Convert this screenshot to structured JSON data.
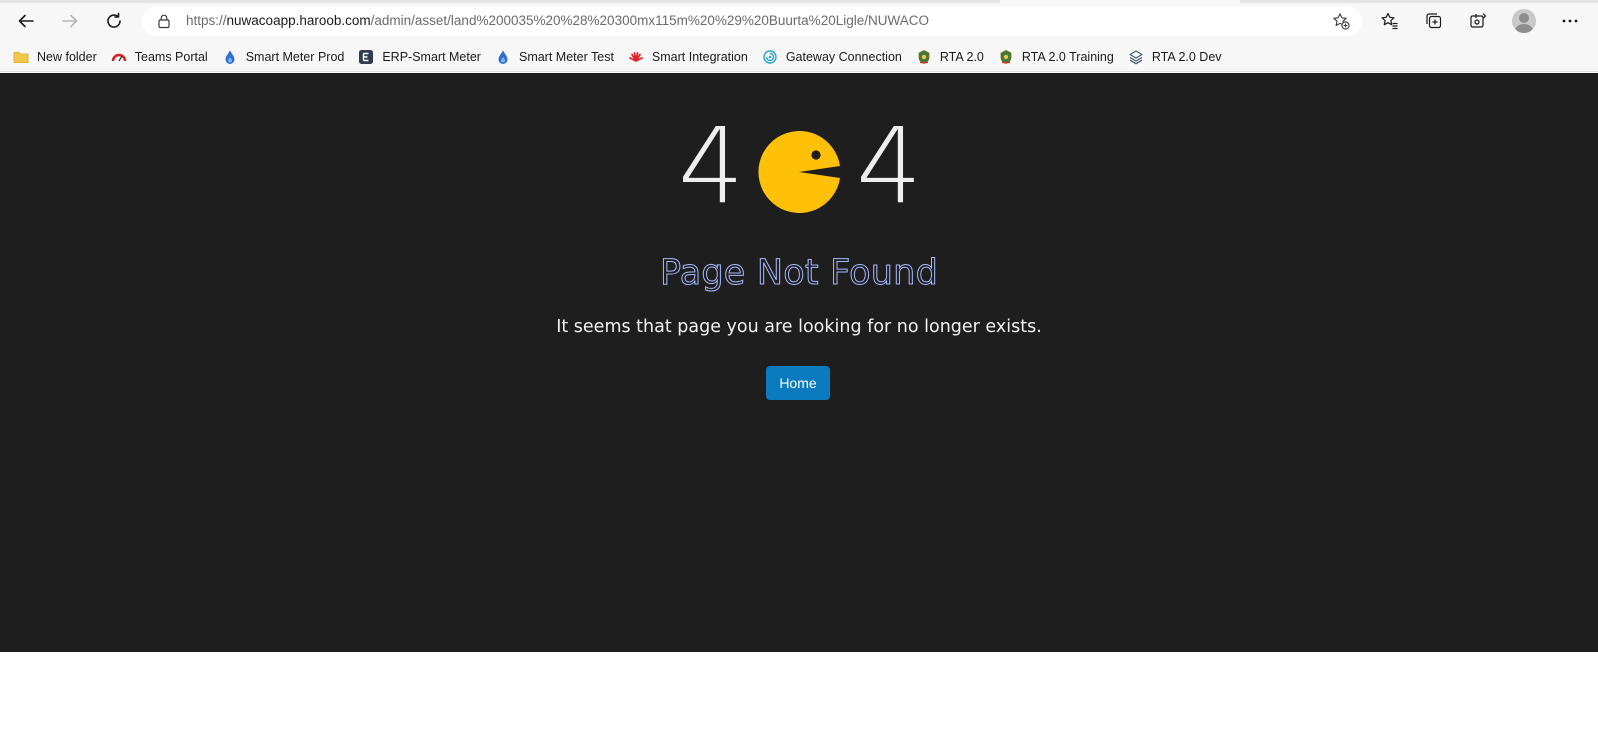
{
  "browser": {
    "url_prefix": "https://",
    "url_host": "nuwacoapp.haroob.com",
    "url_path": "/admin/asset/land%200035%20%28%20300mx115m%20%29%20Buurta%20Ligle/NUWACO"
  },
  "bookmarks": [
    {
      "label": "New folder",
      "icon": "folder-icon"
    },
    {
      "label": "Teams Portal",
      "icon": "gauge-icon"
    },
    {
      "label": "Smart Meter Prod",
      "icon": "water-drop-icon"
    },
    {
      "label": "ERP-Smart Meter",
      "icon": "e-letter-icon"
    },
    {
      "label": "Smart Meter Test",
      "icon": "water-drop-icon"
    },
    {
      "label": "Smart Integration",
      "icon": "huawei-icon"
    },
    {
      "label": "Gateway Connection",
      "icon": "spiral-icon"
    },
    {
      "label": "RTA 2.0",
      "icon": "emblem-icon"
    },
    {
      "label": "RTA 2.0 Training",
      "icon": "emblem-icon"
    },
    {
      "label": "RTA 2.0 Dev",
      "icon": "layers-icon"
    }
  ],
  "error_page": {
    "code_first": "4",
    "code_last": "4",
    "title": "Page Not Found",
    "message": "It seems that page you are looking for no longer exists.",
    "home_label": "Home"
  },
  "colors": {
    "page_background": "#1e1e1e",
    "pacman": "#ffc107",
    "title_outline": "#a9b7ff",
    "home_button": "#0a7bbf"
  }
}
